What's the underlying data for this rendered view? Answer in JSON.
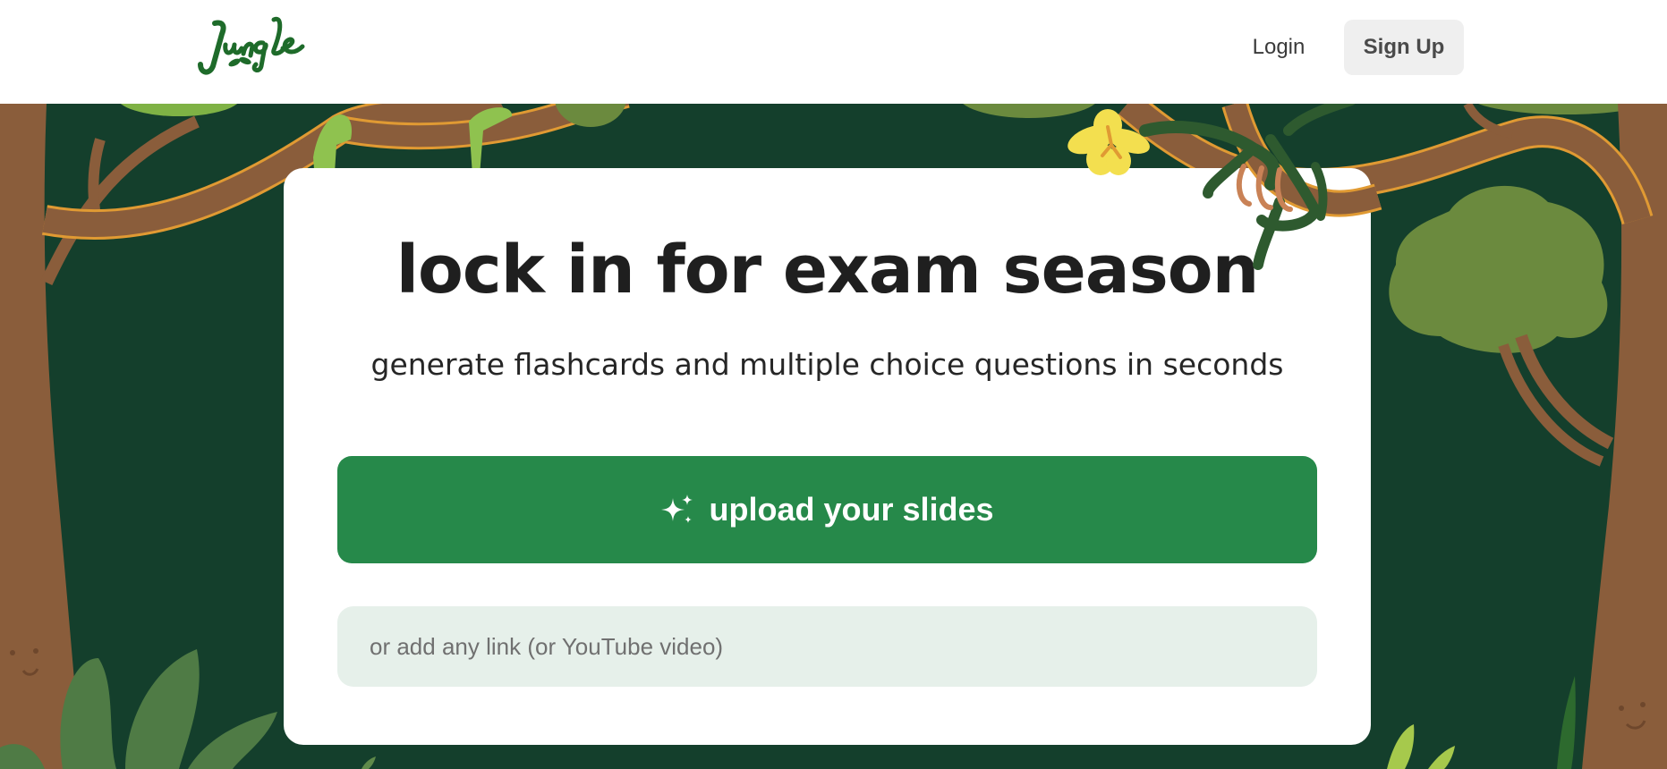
{
  "header": {
    "logo_text": "Jungle",
    "login_label": "Login",
    "signup_label": "Sign Up"
  },
  "hero": {
    "headline": "lock in for exam season",
    "subheadline": "generate flashcards and multiple choice questions in seconds",
    "upload_label": "upload your slides",
    "upload_icon": "sparkles-icon",
    "link_placeholder": "or add any link (or YouTube video)"
  },
  "colors": {
    "background": "#143f2c",
    "brand_green": "#26894a",
    "logo_green": "#1e6b2a",
    "input_background": "#e6f0ea",
    "trunk_brown": "#8a5d3b",
    "vine_outline": "#e09a33"
  }
}
